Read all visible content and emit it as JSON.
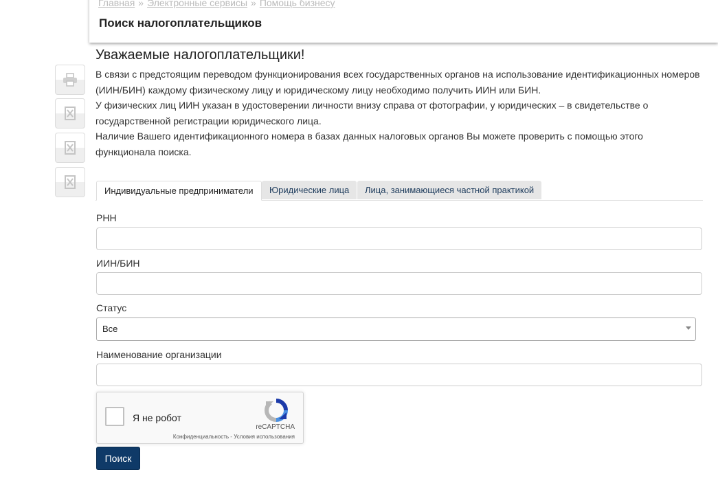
{
  "breadcrumb": [
    {
      "label": "Главная"
    },
    {
      "label": "Электронные сервисы"
    },
    {
      "label": "Помощь бизнесу"
    }
  ],
  "breadcrumb_separator": "»",
  "page_title": "Поиск налогоплательщиков",
  "side_toolbar": {
    "icons": [
      "printer-icon",
      "excel-icon",
      "excel-icon",
      "excel-icon"
    ]
  },
  "greeting": "Уважаемые налогоплательщики!",
  "intro": [
    "В связи с предстоящим переводом функционирования всех государственных органов на использование идентификационных номеров (ИИН/БИН) каждому физическому лицу и юридическому лицу необходимо получить ИИН или БИН.",
    "У физических лиц ИИН указан в удостоверении личности внизу справа от фотографии, у юридических – в свидетельстве о государственной регистрации юридического лица.",
    "Наличие Вашего идентификационного номера в базах данных налоговых органов Вы можете проверить с помощью этого функционала поиска."
  ],
  "tabs": [
    {
      "label": "Индивидуальные предприниматели",
      "active": true
    },
    {
      "label": "Юридические лица",
      "active": false
    },
    {
      "label": "Лица, занимающиеся частной практикой",
      "active": false
    }
  ],
  "form": {
    "rnn_label": "РНН",
    "rnn_value": "",
    "iin_label": "ИИН/БИН",
    "iin_value": "",
    "status_label": "Статус",
    "status_value": "Все",
    "org_name_label": "Наименование организации",
    "org_name_value": ""
  },
  "recaptcha": {
    "label": "Я не робот",
    "brand": "reCAPTCHA",
    "privacy": "Конфиденциальность",
    "separator": "-",
    "terms": "Условия использования"
  },
  "search_button": "Поиск",
  "colors": {
    "button_bg": "#0f3a68",
    "tab_inactive_bg": "#e6e6e6",
    "tab_inactive_text": "#1d3b5c"
  }
}
